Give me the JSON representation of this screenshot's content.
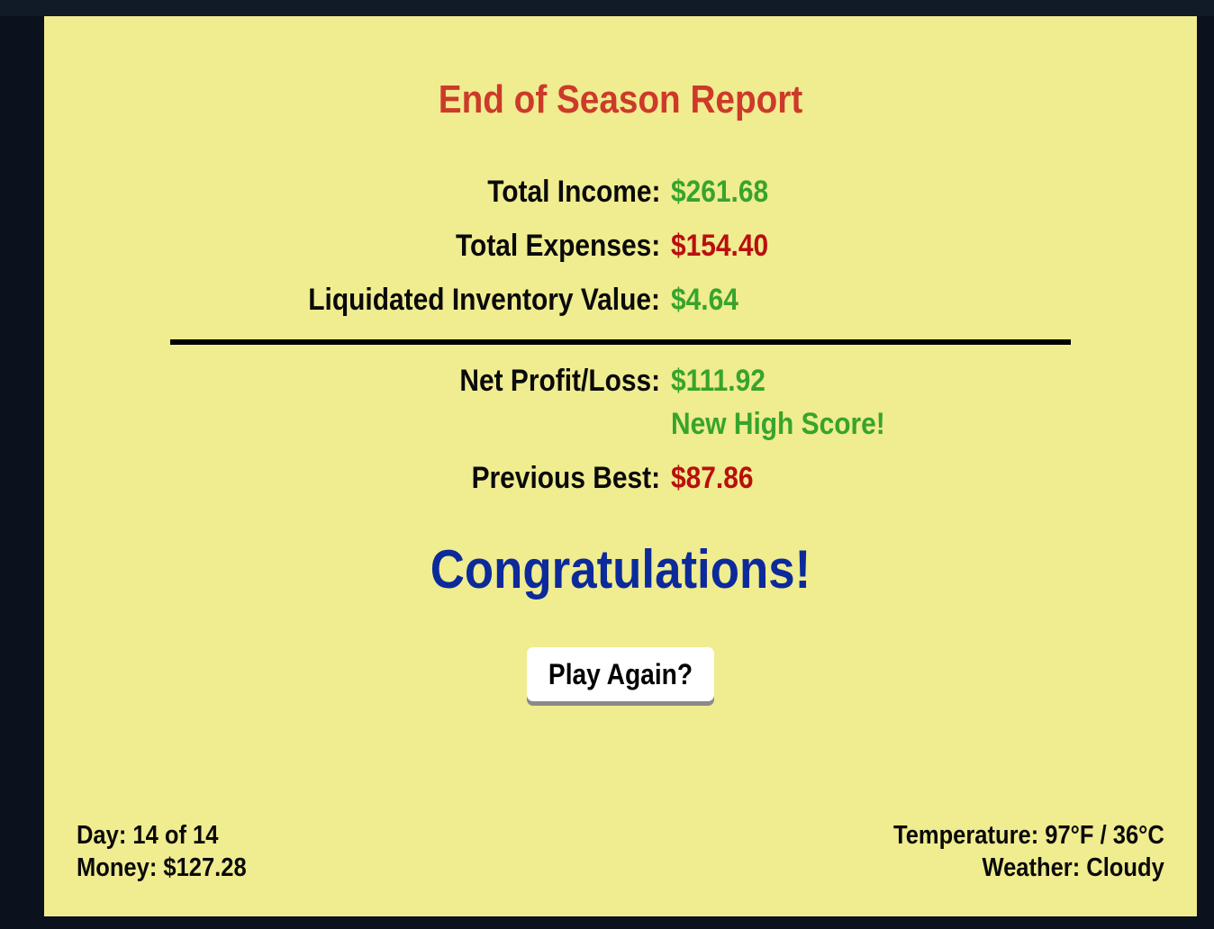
{
  "report": {
    "title": "End of Season Report",
    "rows": [
      {
        "label": "Total Income:",
        "value": "$261.68",
        "color": "#37a42c"
      },
      {
        "label": "Total Expenses:",
        "value": "$154.40",
        "color": "#b80f0f"
      },
      {
        "label": "Liquidated Inventory Value:",
        "value": "$4.64",
        "color": "#37a42c"
      }
    ],
    "net": {
      "label": "Net Profit/Loss:",
      "value": "$111.92",
      "color": "#37a42c"
    },
    "high_score_note": "New High Score!",
    "previous_best": {
      "label": "Previous Best:",
      "value": "$87.86",
      "color": "#b80f0f"
    },
    "message": "Congratulations!",
    "play_again_label": "Play Again?"
  },
  "status": {
    "day": "Day: 14 of 14",
    "money": "Money: $127.28",
    "temperature": "Temperature: 97°F / 36°C",
    "weather": "Weather: Cloudy"
  }
}
